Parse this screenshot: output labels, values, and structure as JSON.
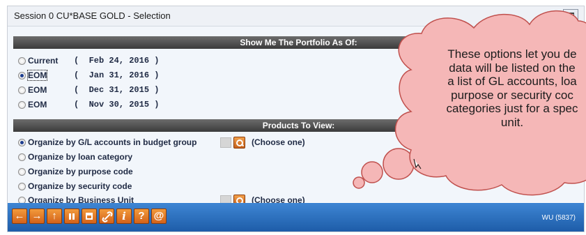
{
  "window": {
    "title": "Session 0 CU*BASE GOLD - Selection"
  },
  "portfolio": {
    "header": "Show Me The Portfolio As Of:",
    "options": [
      {
        "label": "Current",
        "date": "(  Feb 24, 2016 )",
        "selected": false
      },
      {
        "label": "EOM",
        "date": "(  Jan 31, 2016 )",
        "selected": true
      },
      {
        "label": "EOM",
        "date": "(  Dec 31, 2015 )",
        "selected": false
      },
      {
        "label": "EOM",
        "date": "(  Nov 30, 2015 )",
        "selected": false
      }
    ]
  },
  "products": {
    "header": "Products To View:",
    "options": [
      {
        "label": "Organize by G/L accounts in budget group",
        "selected": true,
        "picker_text": "(Choose one)"
      },
      {
        "label": "Organize by loan category",
        "selected": false
      },
      {
        "label": "Organize by purpose code",
        "selected": false
      },
      {
        "label": "Organize by security code",
        "selected": false
      },
      {
        "label": "Organize by Business Unit",
        "selected": false,
        "picker_text": "(Choose one)"
      }
    ]
  },
  "toolbar": {
    "buttons": [
      {
        "name": "back-arrow-icon",
        "glyph": "←"
      },
      {
        "name": "forward-arrow-icon",
        "glyph": "→"
      },
      {
        "name": "up-arrow-icon",
        "glyph": "↑"
      },
      {
        "name": "pause-bars-icon",
        "glyph": ""
      },
      {
        "name": "printer-icon",
        "glyph": ""
      },
      {
        "name": "link-icon",
        "glyph": "☍"
      },
      {
        "name": "info-icon",
        "glyph": "i"
      },
      {
        "name": "help-icon",
        "glyph": "?"
      },
      {
        "name": "at-icon",
        "glyph": "@"
      }
    ],
    "status": "WU (5837)"
  },
  "callout": {
    "text": "These options let you de\ndata will be listed on the\na list of GL accounts, loa\npurpose or security coc\ncategories just for a spec\nunit."
  },
  "colors": {
    "callout_fill": "#f5b7b7",
    "callout_stroke": "#c0504d",
    "toolbar": "#2a6fc0",
    "button": "#e8792a"
  }
}
